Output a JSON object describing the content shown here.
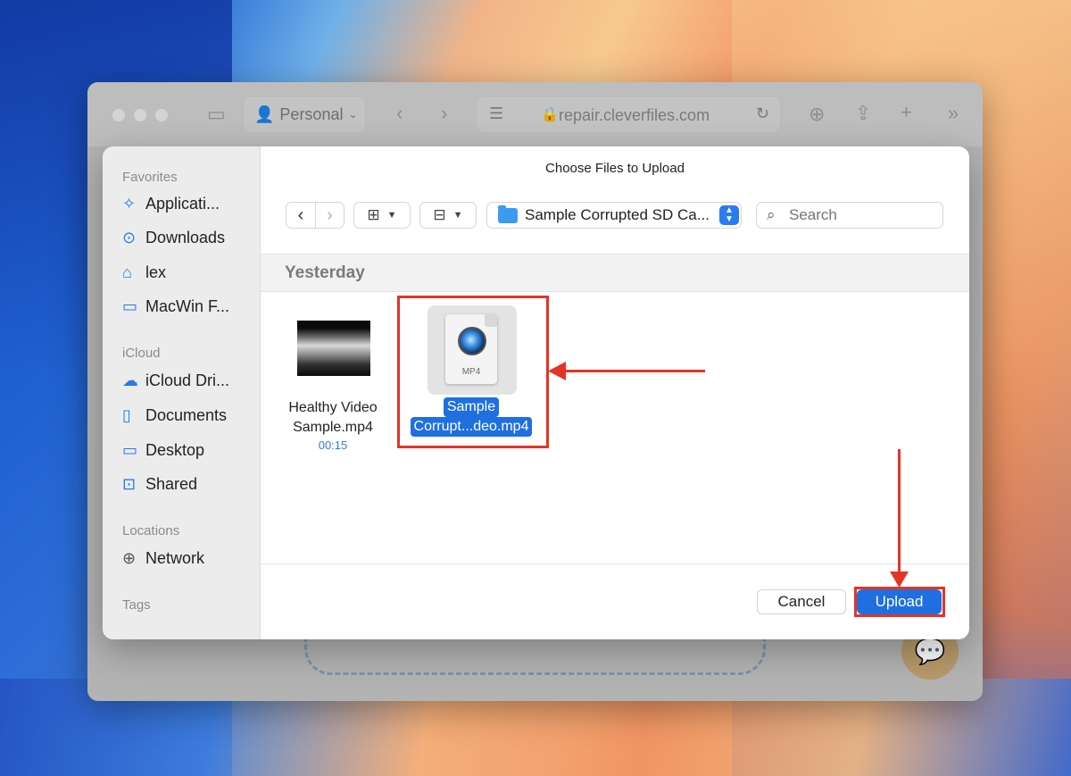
{
  "browser": {
    "profile_label": "Personal",
    "url": "repair.cleverfiles.com"
  },
  "dialog": {
    "title": "Choose Files to Upload",
    "location": "Sample Corrupted SD Ca...",
    "search_placeholder": "Search",
    "group_header": "Yesterday",
    "cancel_label": "Cancel",
    "upload_label": "Upload"
  },
  "sidebar": {
    "favorites_label": "Favorites",
    "favorites": [
      {
        "label": "Applicati...",
        "icon": "app-store-icon"
      },
      {
        "label": "Downloads",
        "icon": "download-circle-icon"
      },
      {
        "label": "lex",
        "icon": "home-icon"
      },
      {
        "label": "MacWin F...",
        "icon": "folder-icon"
      }
    ],
    "icloud_label": "iCloud",
    "icloud": [
      {
        "label": "iCloud Dri...",
        "icon": "cloud-icon"
      },
      {
        "label": "Documents",
        "icon": "document-icon"
      },
      {
        "label": "Desktop",
        "icon": "desktop-icon"
      },
      {
        "label": "Shared",
        "icon": "shared-folder-icon"
      }
    ],
    "locations_label": "Locations",
    "locations": [
      {
        "label": "Network",
        "icon": "globe-icon"
      }
    ],
    "tags_label": "Tags"
  },
  "files": [
    {
      "line1": "Healthy Video",
      "line2": "Sample.mp4",
      "duration": "00:15"
    },
    {
      "line1": "Sample",
      "line2": "Corrupt...deo.mp4",
      "badge": "MP4",
      "selected": true
    }
  ],
  "colors": {
    "accent": "#1f6fe0",
    "annotation": "#e53425"
  }
}
